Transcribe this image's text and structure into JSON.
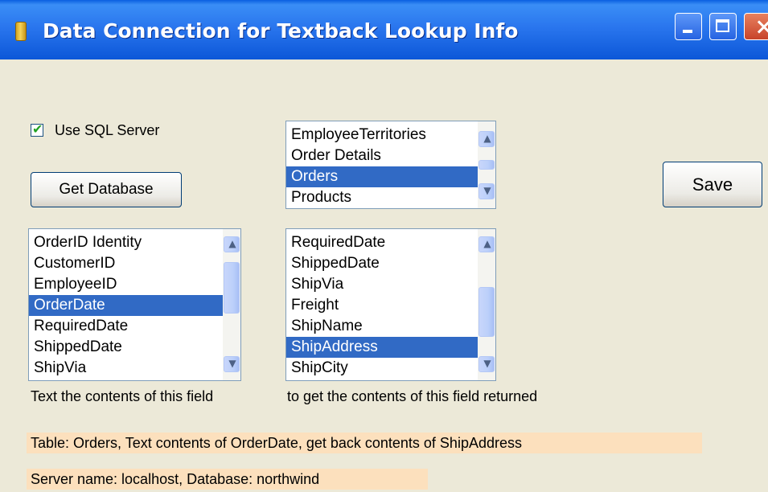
{
  "window": {
    "title": "Data Connection for Textback Lookup Info",
    "icon": "database-icon"
  },
  "use_sql_server": {
    "label": "Use SQL Server",
    "checked": true
  },
  "get_database_button": "Get Database",
  "save_button": "Save",
  "tables_list": {
    "items": [
      "EmployeeTerritories",
      "Order Details",
      "Orders",
      "Products"
    ],
    "selected": "Orders"
  },
  "lookup_fields_list": {
    "items": [
      "OrderID Identity",
      "CustomerID",
      "EmployeeID",
      "OrderDate",
      "RequiredDate",
      "ShippedDate",
      "ShipVia"
    ],
    "selected": "OrderDate"
  },
  "return_fields_list": {
    "items": [
      "RequiredDate",
      "ShippedDate",
      "ShipVia",
      "Freight",
      "ShipName",
      "ShipAddress",
      "ShipCity"
    ],
    "selected": "ShipAddress"
  },
  "captions": {
    "lookup": "Text the contents of this field",
    "return": "to get the contents of this field returned"
  },
  "summary": {
    "query": "Table: Orders, Text contents of OrderDate, get back contents of ShipAddress",
    "connection": "Server name: localhost, Database: northwind"
  },
  "colors": {
    "title_bar": "#0a5fe0",
    "selection": "#316ac5",
    "summary_highlight": "#fce0bd",
    "window_background": "#ece9d8"
  }
}
